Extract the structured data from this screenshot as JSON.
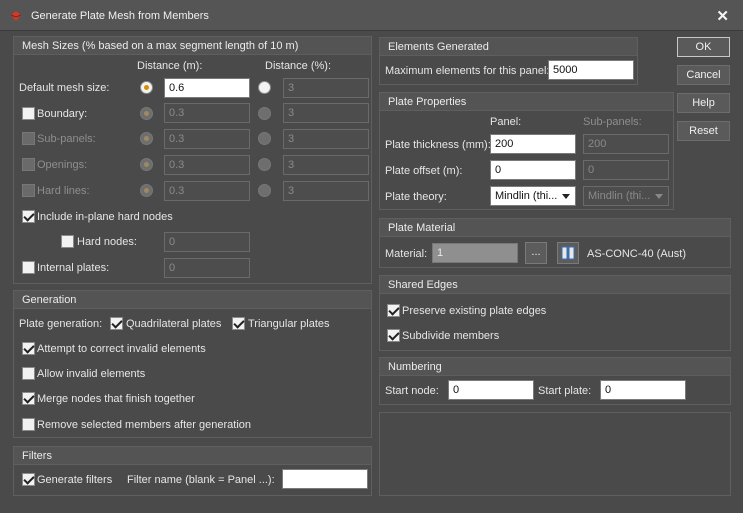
{
  "window": {
    "title": "Generate Plate Mesh from Members",
    "close_label": "✕"
  },
  "buttons": {
    "ok": "OK",
    "cancel": "Cancel",
    "help": "Help",
    "reset": "Reset"
  },
  "mesh_sizes": {
    "header": "Mesh Sizes (% based on a max segment length of 10 m)",
    "col_distance_m": "Distance (m):",
    "col_distance_pct": "Distance (%):",
    "default": {
      "label": "Default mesh size:",
      "m_value": "0.6",
      "pct_value": "3"
    },
    "boundary": {
      "label": "Boundary:",
      "m_value": "0.3",
      "pct_value": "3"
    },
    "subpanels": {
      "label": "Sub-panels:",
      "m_value": "0.3",
      "pct_value": "3"
    },
    "openings": {
      "label": "Openings:",
      "m_value": "0.3",
      "pct_value": "3"
    },
    "hard_lines": {
      "label": "Hard lines:",
      "m_value": "0.3",
      "pct_value": "3"
    },
    "include_hard_nodes": {
      "label": "Include in-plane hard nodes"
    },
    "hard_nodes": {
      "label": "Hard nodes:",
      "value": "0"
    },
    "internal_plates": {
      "label": "Internal plates:",
      "value": "0"
    }
  },
  "generation": {
    "header": "Generation",
    "plate_generation_label": "Plate generation:",
    "quadrilateral": "Quadrilateral plates",
    "triangular": "Triangular plates",
    "attempt_correct": "Attempt to correct invalid elements",
    "allow_invalid": "Allow invalid elements",
    "merge_nodes": "Merge nodes that finish together",
    "remove_members": "Remove selected members after generation"
  },
  "filters": {
    "header": "Filters",
    "generate_filters": "Generate filters",
    "filter_name_label": "Filter name (blank = Panel ...):",
    "filter_name_value": ""
  },
  "elements_generated": {
    "header": "Elements Generated",
    "max_label": "Maximum elements for this panel:",
    "max_value": "5000"
  },
  "plate_properties": {
    "header": "Plate Properties",
    "col_panel": "Panel:",
    "col_subpanels": "Sub-panels:",
    "thickness_label": "Plate thickness (mm):",
    "thickness_panel": "200",
    "thickness_sub": "200",
    "offset_label": "Plate offset (m):",
    "offset_panel": "0",
    "offset_sub": "0",
    "theory_label": "Plate theory:",
    "theory_panel": "Mindlin (thi...",
    "theory_sub": "Mindlin (thi..."
  },
  "plate_material": {
    "header": "Plate Material",
    "material_label": "Material:",
    "material_value": "1",
    "browse_label": "...",
    "material_name": "AS-CONC-40 (Aust)"
  },
  "shared_edges": {
    "header": "Shared Edges",
    "preserve": "Preserve existing plate edges",
    "subdivide": "Subdivide members"
  },
  "numbering": {
    "header": "Numbering",
    "start_node_label": "Start node:",
    "start_node_value": "0",
    "start_plate_label": "Start plate:",
    "start_plate_value": "0"
  },
  "colors": {
    "accent_radio": "#d88d00",
    "background": "#4a4a4a",
    "header": "#545454"
  }
}
